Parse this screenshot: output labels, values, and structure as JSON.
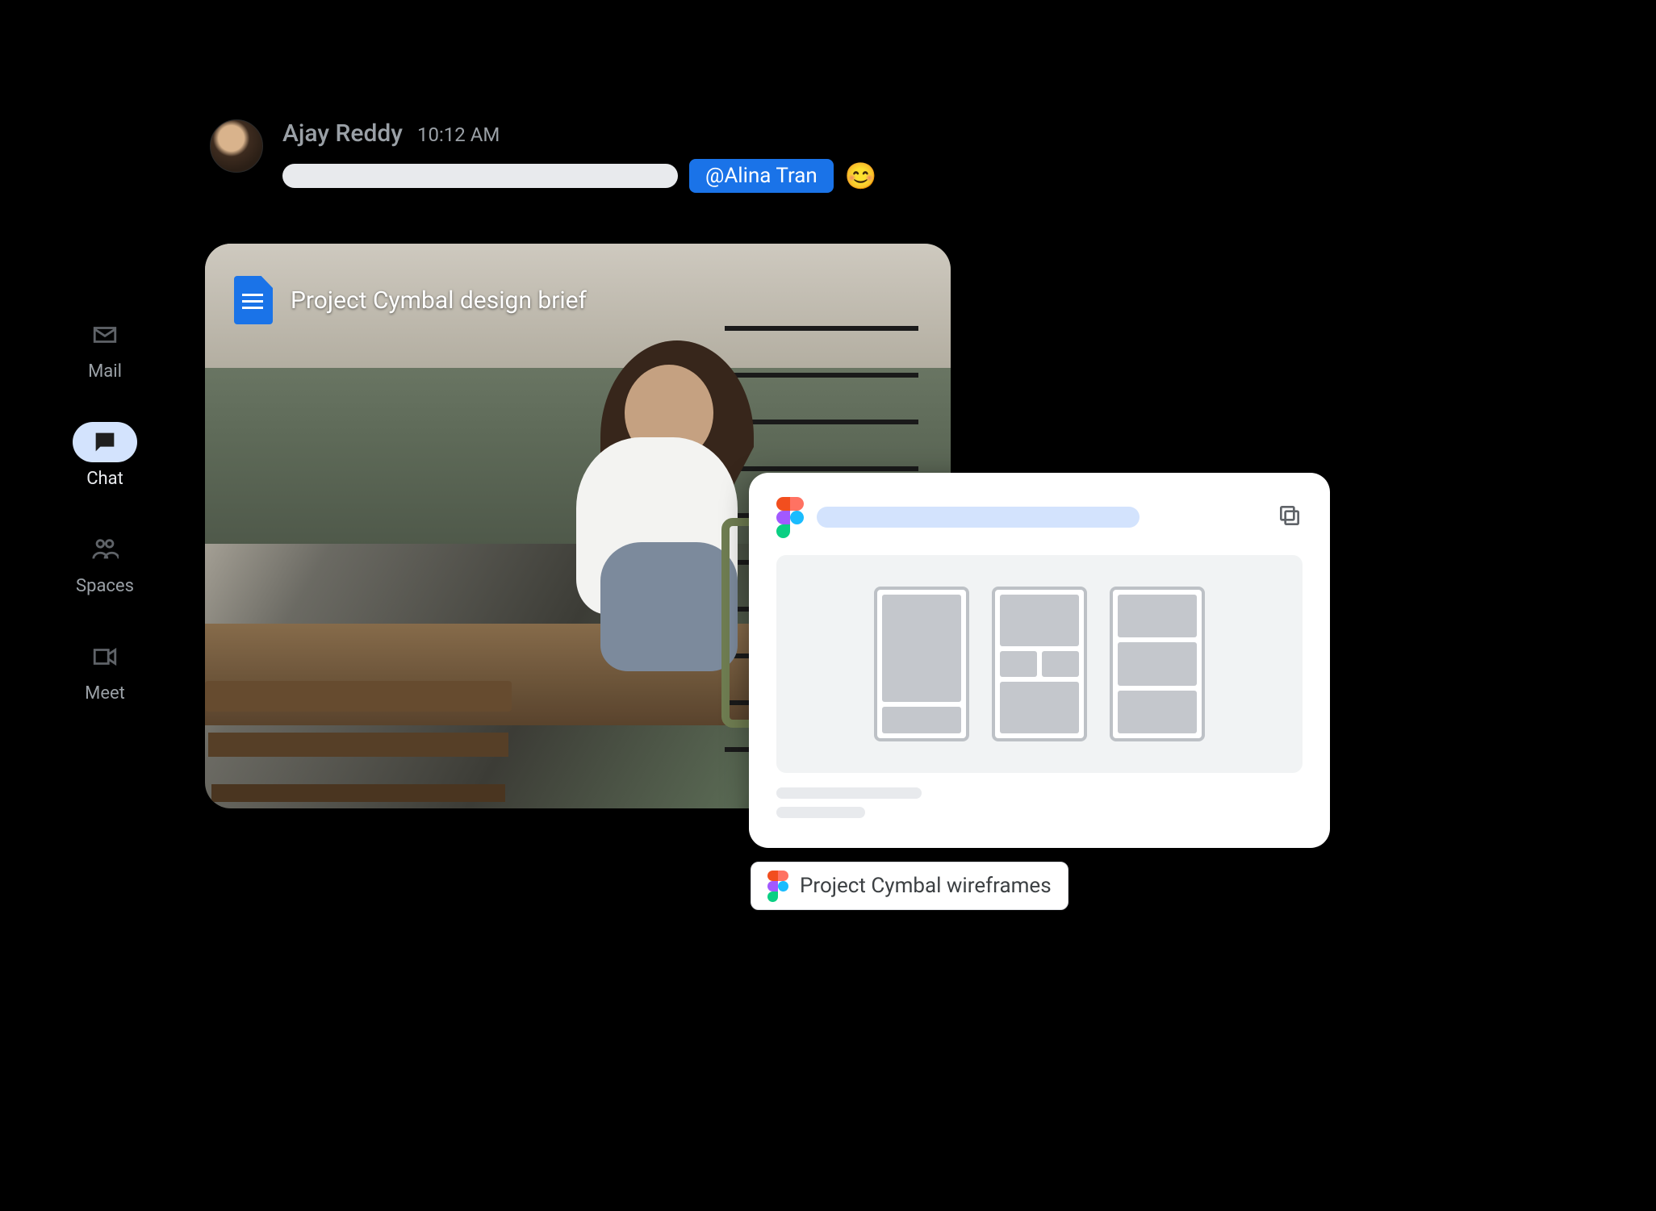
{
  "nav": {
    "items": [
      {
        "id": "mail",
        "label": "Mail",
        "active": false
      },
      {
        "id": "chat",
        "label": "Chat",
        "active": true
      },
      {
        "id": "spaces",
        "label": "Spaces",
        "active": false
      },
      {
        "id": "meet",
        "label": "Meet",
        "active": false
      }
    ]
  },
  "message": {
    "sender": "Ajay Reddy",
    "timestamp": "10:12 AM",
    "mention": "@Alina Tran",
    "reaction_emoji": "😊"
  },
  "doc_attachment": {
    "title": "Project Cymbal design brief",
    "app": "Google Docs"
  },
  "figma_attachment": {
    "chip_label": "Project Cymbal wireframes",
    "app": "Figma"
  }
}
